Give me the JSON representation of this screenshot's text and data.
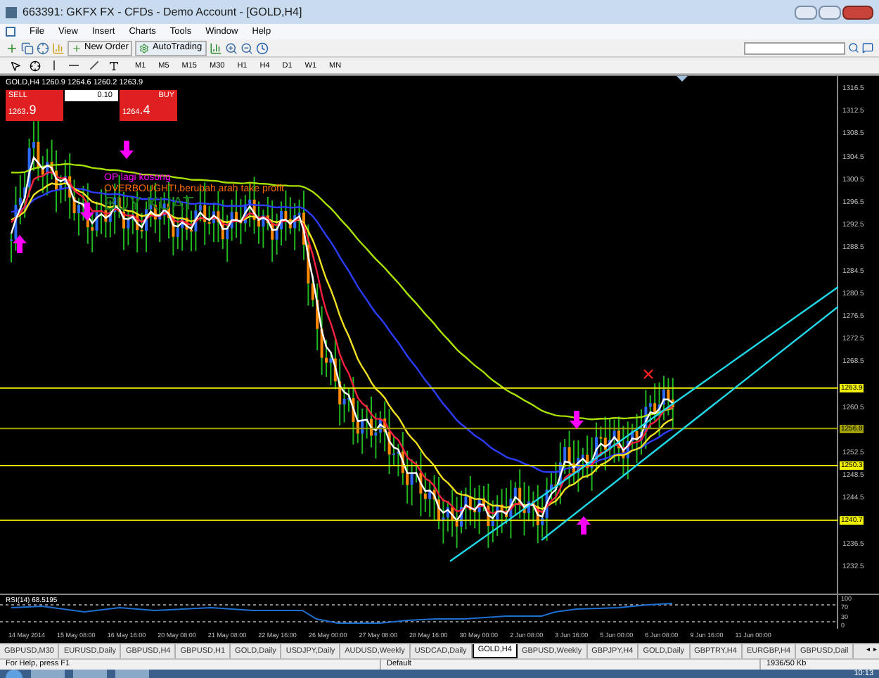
{
  "window": {
    "title": "663391: GKFX FX - CFDs - Demo Account - [GOLD,H4]"
  },
  "menu": [
    "File",
    "View",
    "Insert",
    "Charts",
    "Tools",
    "Window",
    "Help"
  ],
  "toolbar": {
    "new_order": "New Order",
    "auto_trading": "AutoTrading"
  },
  "timeframes": [
    "M1",
    "M5",
    "M15",
    "M30",
    "H1",
    "H4",
    "D1",
    "W1",
    "MN"
  ],
  "chart": {
    "header": "GOLD,H4  1260.9 1264.6 1260.2 1263.9",
    "trade_panel": {
      "sell_label": "SELL",
      "buy_label": "BUY",
      "lot": "0.10",
      "sell_price_main": "1263",
      "sell_price_pips": ".9",
      "buy_price_main": "1264",
      "buy_price_pips": ".4"
    },
    "annotations": [
      {
        "kind": "note",
        "text": "OP lagi kosong",
        "color": "#ff00ff"
      },
      {
        "kind": "note",
        "text": "OVERBOUGHT!,berubah arah take profit",
        "color": "#ff6a00"
      },
      {
        "kind": "banner",
        "text": "BUY KUAT",
        "color": "#1e7a1e"
      }
    ],
    "price_axis": [
      "1316.5",
      "1312.5",
      "1308.5",
      "1304.5",
      "1300.5",
      "1296.5",
      "1292.5",
      "1288.5",
      "1284.5",
      "1280.5",
      "1276.5",
      "1272.5",
      "1268.5",
      "1260.5",
      "1252.5",
      "1248.5",
      "1244.5",
      "1236.5",
      "1232.5"
    ],
    "levels": [
      {
        "label": "1263.9",
        "current": true
      },
      {
        "label": "1256.8",
        "current": false
      },
      {
        "label": "1250.3",
        "current": true
      },
      {
        "label": "1240.7",
        "current": true
      }
    ],
    "arrows": [
      {
        "kind": "down"
      },
      {
        "kind": "down"
      },
      {
        "kind": "down"
      },
      {
        "kind": "up"
      },
      {
        "kind": "up"
      }
    ]
  },
  "rsi": {
    "label": "RSI(14) 68.5195",
    "scale": [
      "100",
      "70",
      "30",
      "0"
    ]
  },
  "date_axis": [
    "14 May 2014",
    "15 May 08:00",
    "16 May 16:00",
    "20 May 08:00",
    "21 May 08:00",
    "22 May 16:00",
    "26 May 00:00",
    "27 May 08:00",
    "28 May 16:00",
    "30 May 00:00",
    "2 Jun 08:00",
    "3 Jun 16:00",
    "5 Jun 00:00",
    "6 Jun 08:00",
    "9 Jun 16:00",
    "11 Jun 00:00"
  ],
  "tabs": [
    {
      "label": "GBPUSD,M30",
      "selected": false
    },
    {
      "label": "EURUSD,Daily",
      "selected": false
    },
    {
      "label": "GBPUSD,H4",
      "selected": false
    },
    {
      "label": "GBPUSD,H1",
      "selected": false
    },
    {
      "label": "GOLD,Daily",
      "selected": false
    },
    {
      "label": "USDJPY,Daily",
      "selected": false
    },
    {
      "label": "AUDUSD,Weekly",
      "selected": false
    },
    {
      "label": "USDCAD,Daily",
      "selected": false
    },
    {
      "label": "GOLD,H4",
      "selected": true
    },
    {
      "label": "GBPUSD,Weekly",
      "selected": false
    },
    {
      "label": "GBPJPY,H4",
      "selected": false
    },
    {
      "label": "GOLD,Daily",
      "selected": false
    },
    {
      "label": "GBPTRY,H4",
      "selected": false
    },
    {
      "label": "EURGBP,H4",
      "selected": false
    },
    {
      "label": "GBPUSD,Dail",
      "selected": false
    }
  ],
  "tab_scroll": {
    "left": "◂",
    "right": "▸"
  },
  "status_bar": {
    "help": "For Help, press F1",
    "profile": "Default",
    "traffic": "1936/50 Kb"
  },
  "taskbar": {
    "clock": "10:13"
  }
}
